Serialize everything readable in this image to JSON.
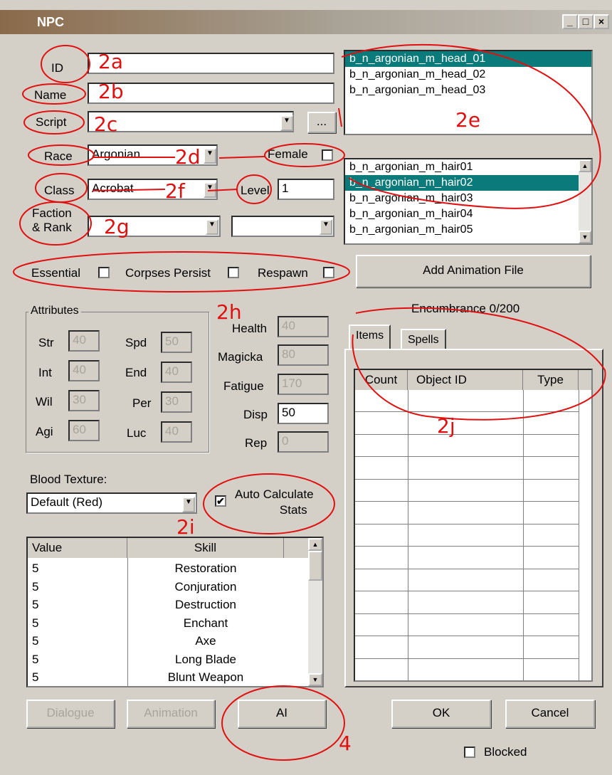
{
  "window": {
    "title": "NPC"
  },
  "fields": {
    "id_label": "ID",
    "name_label": "Name",
    "script_label": "Script",
    "race_label": "Race",
    "race_value": "Argonian",
    "female_label": "Female",
    "class_label": "Class",
    "class_value": "Acrobat",
    "level_label": "Level",
    "level_value": "1",
    "faction_label_1": "Faction",
    "faction_label_2": "& Rank",
    "browse_label": "..."
  },
  "head_list": [
    "b_n_argonian_m_head_01",
    "b_n_argonian_m_head_02",
    "b_n_argonian_m_head_03"
  ],
  "hair_list": [
    "b_n_argonian_m_hair01",
    "b_n_argonian_m_hair02",
    "b_n_argonian_m_hair03",
    "b_n_argonian_m_hair04",
    "b_n_argonian_m_hair05"
  ],
  "flags": {
    "essential": "Essential",
    "corpses": "Corpses Persist",
    "respawn": "Respawn"
  },
  "add_animation": "Add Animation File",
  "encumbrance": "Encumbrance 0/200",
  "attributes": {
    "title": "Attributes",
    "str_label": "Str",
    "str": "40",
    "spd_label": "Spd",
    "spd": "50",
    "int_label": "Int",
    "int": "40",
    "end_label": "End",
    "end": "40",
    "wil_label": "Wil",
    "wil": "30",
    "per_label": "Per",
    "per": "30",
    "agi_label": "Agi",
    "agi": "60",
    "luc_label": "Luc",
    "luc": "40"
  },
  "stats": {
    "health_label": "Health",
    "health": "40",
    "magicka_label": "Magicka",
    "magicka": "80",
    "fatigue_label": "Fatigue",
    "fatigue": "170",
    "disp_label": "Disp",
    "disp": "50",
    "rep_label": "Rep",
    "rep": "0"
  },
  "tabs": [
    "Items",
    "Spells"
  ],
  "inventory_headers": [
    "Count",
    "Object ID",
    "Type"
  ],
  "blood": {
    "label": "Blood Texture:",
    "value": "Default (Red)"
  },
  "autocalc": {
    "line1": "Auto Calculate",
    "line2": "Stats",
    "checked": true
  },
  "skills": {
    "headers": [
      "Value",
      "Skill"
    ],
    "rows": [
      {
        "value": "5",
        "skill": "Restoration"
      },
      {
        "value": "5",
        "skill": "Conjuration"
      },
      {
        "value": "5",
        "skill": "Destruction"
      },
      {
        "value": "5",
        "skill": "Enchant"
      },
      {
        "value": "5",
        "skill": "Axe"
      },
      {
        "value": "5",
        "skill": "Long Blade"
      },
      {
        "value": "5",
        "skill": "Blunt Weapon"
      }
    ]
  },
  "buttons": {
    "dialogue": "Dialogue",
    "animation": "Animation",
    "ai": "AI",
    "ok": "OK",
    "cancel": "Cancel"
  },
  "blocked": "Blocked",
  "annotations": {
    "a2a": "2a",
    "a2b": "2b",
    "a2c": "2c",
    "a2d": "2d",
    "a2e": "2e",
    "a2f": "2f",
    "a2g": "2g",
    "a2h": "2h",
    "a2i": "2i",
    "a2j": "2j",
    "a4": "4"
  },
  "colors": {
    "annotation": "#e01010",
    "selection": "#0a7a7a",
    "dialog_bg": "#d4d0c8"
  }
}
